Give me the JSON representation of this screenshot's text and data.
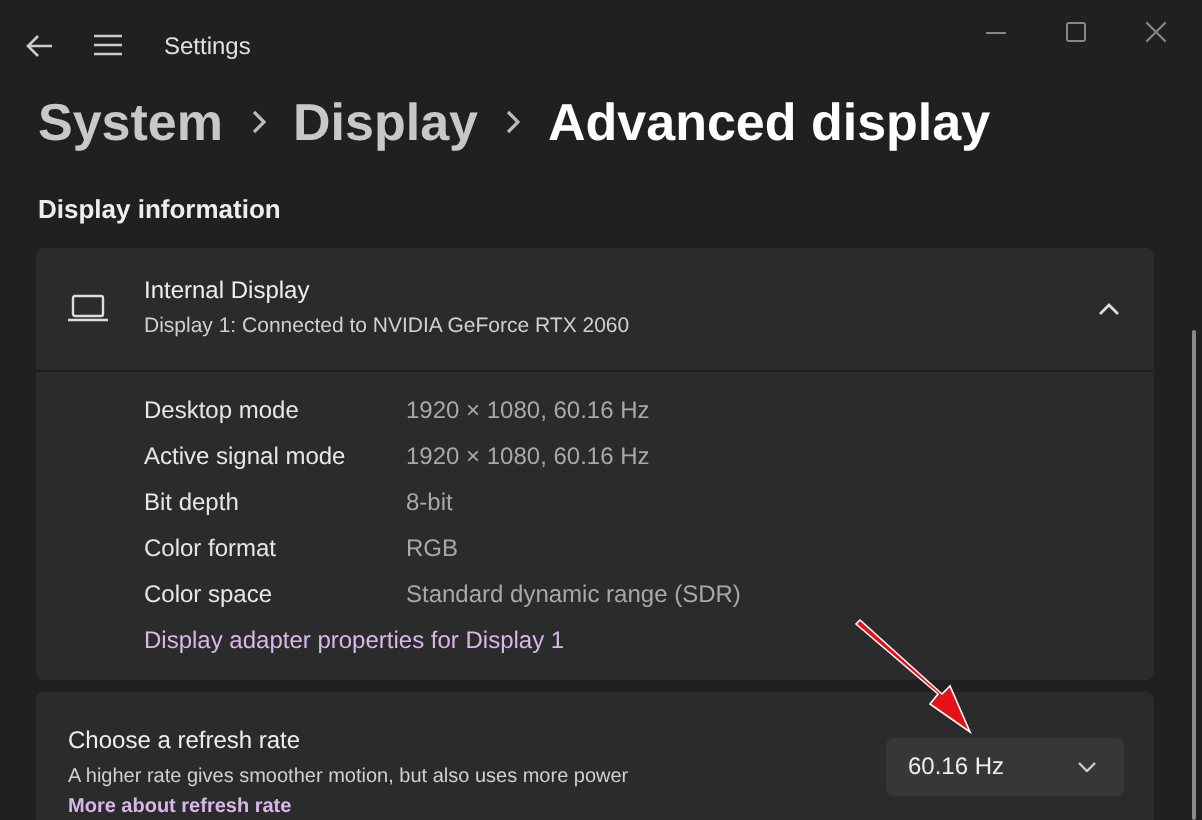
{
  "window": {
    "title": "Settings"
  },
  "breadcrumb": [
    {
      "label": "System",
      "current": false
    },
    {
      "label": "Display",
      "current": false
    },
    {
      "label": "Advanced display",
      "current": true
    }
  ],
  "section_title": "Display information",
  "display_card": {
    "title": "Internal Display",
    "subtitle": "Display 1: Connected to NVIDIA GeForce RTX 2060",
    "expanded": true,
    "properties": [
      {
        "label": "Desktop mode",
        "value": "1920 × 1080, 60.16 Hz"
      },
      {
        "label": "Active signal mode",
        "value": "1920 × 1080, 60.16 Hz"
      },
      {
        "label": "Bit depth",
        "value": "8-bit"
      },
      {
        "label": "Color format",
        "value": "RGB"
      },
      {
        "label": "Color space",
        "value": "Standard dynamic range (SDR)"
      }
    ],
    "link": "Display adapter properties for Display 1"
  },
  "refresh_card": {
    "title": "Choose a refresh rate",
    "description": "A higher rate gives smoother motion, but also uses more power",
    "link": "More about refresh rate",
    "dropdown_value": "60.16 Hz"
  }
}
